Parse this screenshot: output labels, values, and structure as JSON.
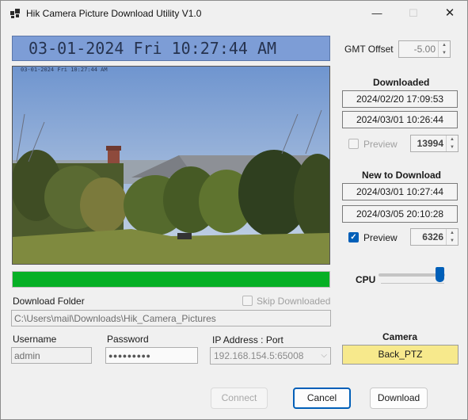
{
  "window": {
    "title": "Hik Camera Picture Download Utility V1.0",
    "minimize_glyph": "—",
    "maximize_glyph": "☐",
    "close_glyph": "✕"
  },
  "camera_view": {
    "timestamp_banner": "03-01-2024 Fri 10:27:44 AM",
    "osd_text": "03-01-2024 Fri 10:27:44 AM"
  },
  "progress": {
    "fraction": 1.0,
    "color": "#06b025"
  },
  "gmt": {
    "label": "GMT Offset",
    "value": "-5.00"
  },
  "downloaded": {
    "heading": "Downloaded",
    "from": "2024/02/20 17:09:53",
    "to": "2024/03/01 10:26:44",
    "preview_label": "Preview",
    "preview_checked": false,
    "count": "13994"
  },
  "new_to_download": {
    "heading": "New to Download",
    "from": "2024/03/01 10:27:44",
    "to": "2024/03/05 20:10:28",
    "preview_label": "Preview",
    "preview_checked": true,
    "count": "6326"
  },
  "cpu": {
    "label": "CPU",
    "level_fraction": 0.98
  },
  "download_folder": {
    "label": "Download Folder",
    "path": "C:\\Users\\mail\\Downloads\\Hik_Camera_Pictures",
    "skip_label": "Skip Downloaded",
    "skip_checked": false
  },
  "credentials": {
    "username_label": "Username",
    "username": "admin",
    "password_label": "Password",
    "password": "●●●●●●●●●",
    "ip_label": "IP Address : Port",
    "ip_value": "192.168.154.5:65008"
  },
  "camera": {
    "label": "Camera",
    "name": "Back_PTZ"
  },
  "buttons": {
    "connect": "Connect",
    "cancel": "Cancel",
    "download": "Download"
  },
  "icons": {
    "checkmark": "✓",
    "spin_up": "▲",
    "spin_down": "▼",
    "dropdown": "⌵"
  }
}
